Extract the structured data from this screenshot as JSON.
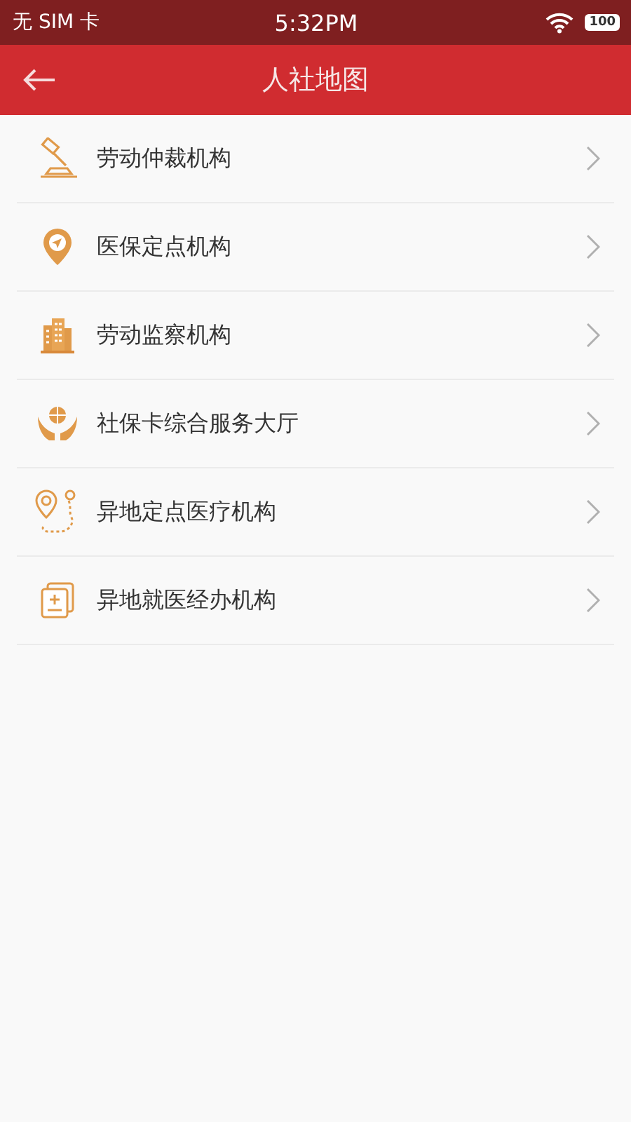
{
  "status_bar": {
    "carrier": "无 SIM 卡",
    "time": "5:32PM",
    "battery": "100"
  },
  "header": {
    "title": "人社地图"
  },
  "items": [
    {
      "label": "劳动仲裁机构",
      "kind": "gavel"
    },
    {
      "label": "医保定点机构",
      "kind": "pin"
    },
    {
      "label": "劳动监察机构",
      "kind": "building"
    },
    {
      "label": "社保卡综合服务大厅",
      "kind": "hands"
    },
    {
      "label": "异地定点医疗机构",
      "kind": "route"
    },
    {
      "label": "异地就医经办机构",
      "kind": "card"
    }
  ]
}
